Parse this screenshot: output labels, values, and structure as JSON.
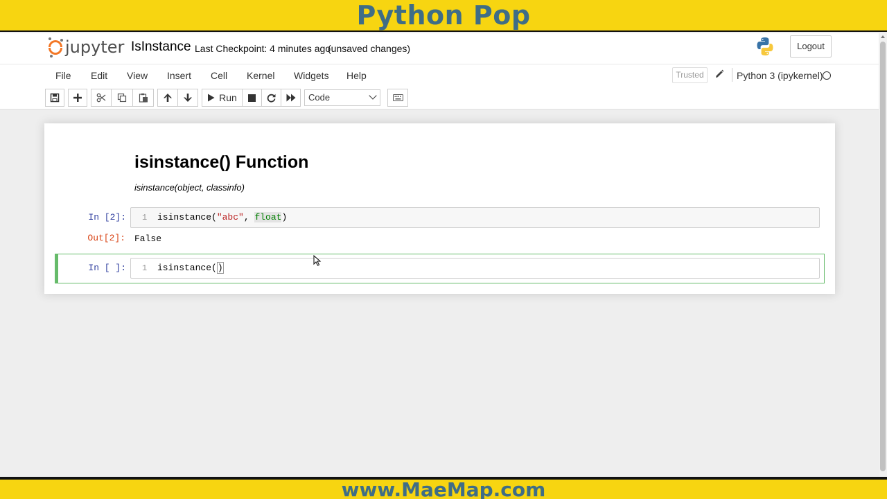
{
  "banner": {
    "top_text": "Python Pop",
    "bottom_text": "www.MaeMap.com",
    "color": "#f7d511",
    "text_color": "#3f6d86"
  },
  "header": {
    "logo_text": "jupyter",
    "notebook_title": "IsInstance",
    "checkpoint": "Last Checkpoint: 4 minutes ago",
    "autosave_status": "(unsaved changes)",
    "logout_label": "Logout"
  },
  "menubar": {
    "items": [
      "File",
      "Edit",
      "View",
      "Insert",
      "Cell",
      "Kernel",
      "Widgets",
      "Help"
    ],
    "trusted_label": "Trusted",
    "kernel_name": "Python 3 (ipykernel)"
  },
  "toolbar": {
    "buttons": [
      "save-icon",
      "plus-icon",
      "scissors-icon",
      "copy-icon",
      "paste-icon",
      "arrow-up-icon",
      "arrow-down-icon",
      "run-icon",
      "stop-icon",
      "restart-icon",
      "fast-forward-icon",
      "keyboard-icon"
    ],
    "run_label": "Run",
    "cell_type": "Code"
  },
  "notebook": {
    "markdown": {
      "heading": "isinstance() Function",
      "signature": "isinstance(object, classinfo)"
    },
    "cells": [
      {
        "prompt_in": "In [2]:",
        "line_number": "1",
        "code_fn": "isinstance(",
        "code_str": "\"abc\"",
        "code_sep": ", ",
        "code_builtin": "float",
        "code_close": ")",
        "prompt_out": "Out[2]:",
        "output": "False"
      },
      {
        "prompt_in": "In [ ]:",
        "line_number": "1",
        "code_fn": "isinstance(",
        "code_close": ")"
      }
    ]
  }
}
